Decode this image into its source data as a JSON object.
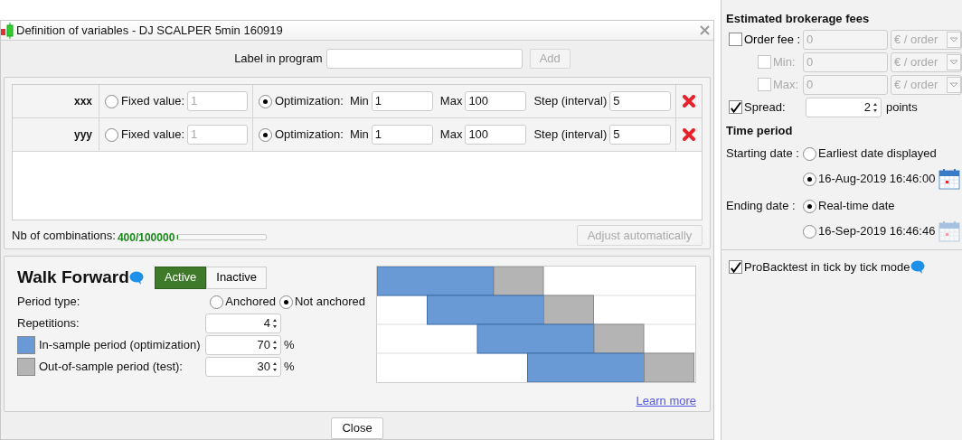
{
  "window": {
    "title": "Definition of variables - DJ SCALPER 5min 160919"
  },
  "label_in_program": {
    "label": "Label in program",
    "add": "Add",
    "add_disabled": true
  },
  "variables": [
    {
      "name": "xxx",
      "fixed_label": "Fixed value:",
      "fixed_value": "1",
      "fixed_selected": false,
      "optimization_label": "Optimization:",
      "optimization_selected": true,
      "min_label": "Min",
      "min": "1",
      "max_label": "Max",
      "max": "100",
      "step_label": "Step (interval)",
      "step": "5"
    },
    {
      "name": "yyy",
      "fixed_label": "Fixed value:",
      "fixed_value": "1",
      "fixed_selected": false,
      "optimization_label": "Optimization:",
      "optimization_selected": true,
      "min_label": "Min",
      "min": "1",
      "max_label": "Max",
      "max": "100",
      "step_label": "Step (interval)",
      "step": "5"
    }
  ],
  "combinations": {
    "label": "Nb of combinations:",
    "value": "400/100000",
    "level": 0.004,
    "adjust": "Adjust automatically",
    "adjust_disabled": true
  },
  "walk_forward": {
    "title": "Walk Forward",
    "tabs": [
      {
        "label": "Active",
        "selected": true
      },
      {
        "label": "Inactive",
        "selected": false
      }
    ],
    "period_type": {
      "label": "Period type:",
      "options": [
        {
          "label": "Anchored",
          "selected": false
        },
        {
          "label": "Not anchored",
          "selected": true
        }
      ]
    },
    "repetitions": {
      "label": "Repetitions:",
      "value": "4"
    },
    "periods": [
      {
        "label": "In-sample period (optimization)",
        "value": "70",
        "unit": "%",
        "color": "#6a9ad6"
      },
      {
        "label": "Out-of-sample period (test):",
        "value": "30",
        "unit": "%",
        "color": "#b4b4b4"
      }
    ],
    "learn_more": "Learn more"
  },
  "close": "Close",
  "side": {
    "brokerage_heading": "Estimated brokerage fees",
    "fees": [
      {
        "label": "Order fee :",
        "checked": false,
        "disabled": false,
        "value": "0",
        "unit": "€ / order"
      },
      {
        "label": "Min:",
        "checked": false,
        "disabled": true,
        "value": "0",
        "unit": "€ / order"
      },
      {
        "label": "Max:",
        "checked": false,
        "disabled": true,
        "value": "0",
        "unit": "€ / order"
      }
    ],
    "spread": {
      "label": "Spread:",
      "checked": true,
      "value": "2",
      "unit": "points"
    },
    "time_heading": "Time period",
    "starting": {
      "label": "Starting date :",
      "options": [
        {
          "label": "Earliest date displayed",
          "selected": false,
          "calendar": false
        },
        {
          "label": "16-Aug-2019 16:46:00",
          "selected": true,
          "calendar": true
        }
      ]
    },
    "ending": {
      "label": "Ending date :",
      "options": [
        {
          "label": "Real-time date",
          "selected": true,
          "calendar": false
        },
        {
          "label": "16-Sep-2019 16:46:46",
          "selected": false,
          "calendar": true
        }
      ]
    },
    "tick_mode": {
      "label": "ProBacktest in tick by tick mode",
      "checked": true
    }
  }
}
